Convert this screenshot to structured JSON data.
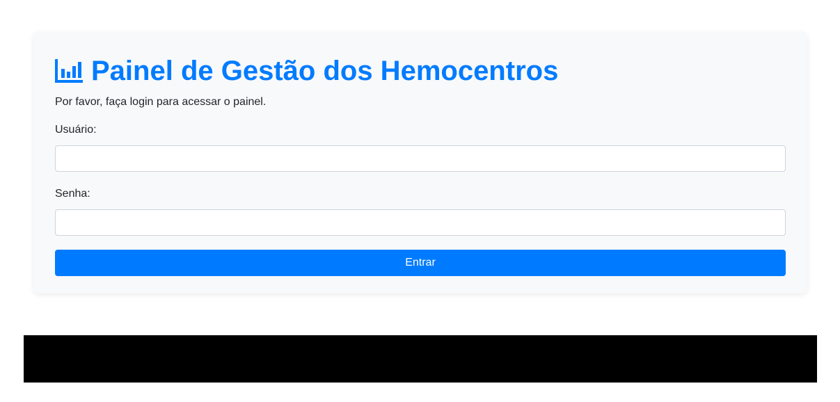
{
  "header": {
    "icon": "bar-chart-icon",
    "title": "Painel de Gestão dos Hemocentros",
    "subtitle": "Por favor, faça login para acessar o painel."
  },
  "form": {
    "username_label": "Usuário:",
    "username_value": "",
    "password_label": "Senha:",
    "password_value": "",
    "submit_label": "Entrar"
  },
  "colors": {
    "accent": "#007bff",
    "card_background": "#f8f9fa",
    "bottom_bar": "#000000"
  }
}
